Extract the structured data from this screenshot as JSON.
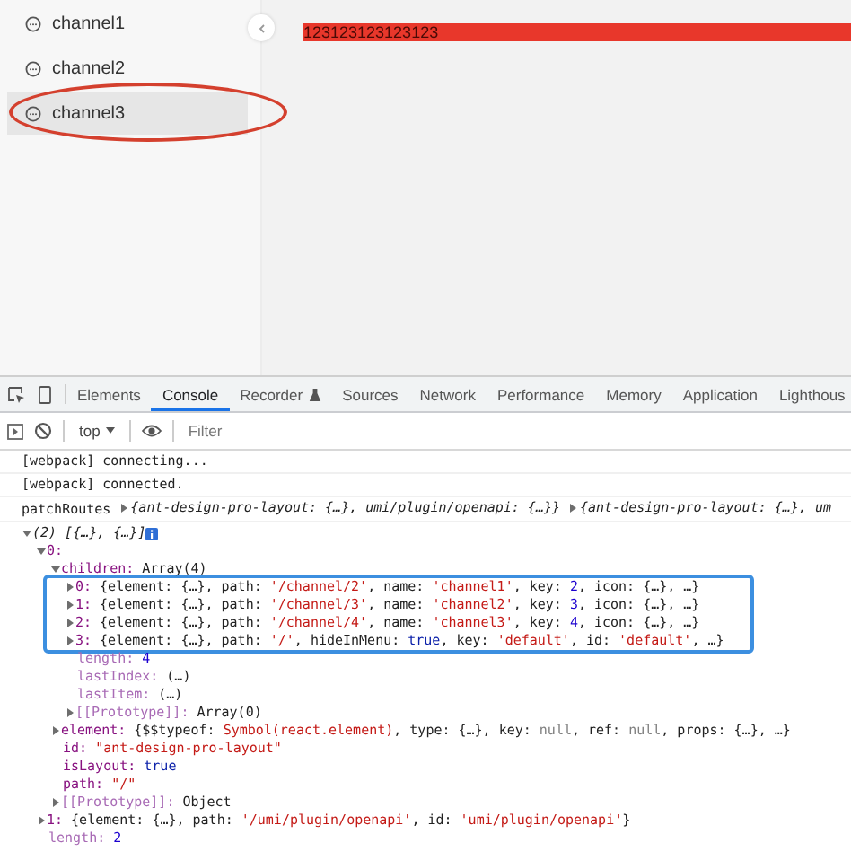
{
  "sidebar": {
    "items": [
      {
        "label": "channel1",
        "selected": false,
        "circled": false
      },
      {
        "label": "channel2",
        "selected": false,
        "circled": false
      },
      {
        "label": "channel3",
        "selected": true,
        "circled": true
      }
    ]
  },
  "content": {
    "banner": "123123123123123"
  },
  "devtools": {
    "tabs": [
      {
        "label": "Elements",
        "selected": false,
        "kind": "plain"
      },
      {
        "label": "Console",
        "selected": true,
        "kind": "plain"
      },
      {
        "label": "Recorder",
        "selected": false,
        "kind": "flask"
      },
      {
        "label": "Sources",
        "selected": false,
        "kind": "plain"
      },
      {
        "label": "Network",
        "selected": false,
        "kind": "plain"
      },
      {
        "label": "Performance",
        "selected": false,
        "kind": "plain"
      },
      {
        "label": "Memory",
        "selected": false,
        "kind": "plain"
      },
      {
        "label": "Application",
        "selected": false,
        "kind": "plain"
      },
      {
        "label": "Lighthous",
        "selected": false,
        "kind": "plain"
      }
    ],
    "context": "top",
    "filter": {
      "placeholder": "Filter"
    }
  },
  "console": {
    "messages": [
      {
        "kind": "text",
        "text": "[webpack] connecting..."
      },
      {
        "kind": "text",
        "text": "[webpack] connected."
      },
      {
        "kind": "log",
        "label": "patchRoutes",
        "previews": [
          "{ant-design-pro-layout: {…}, umi/plugin/openapi: {…}}",
          "{ant-design-pro-layout: {…}, um"
        ]
      },
      {
        "kind": "tree",
        "root": {
          "kind": "toggle",
          "expanded": true,
          "info": true,
          "tokens": [
            {
              "kind": "italic",
              "text": "(2) [{…}, {…}]"
            }
          ],
          "children": [
            {
              "kind": "toggle",
              "expanded": true,
              "tokens": [
                {
                  "kind": "key",
                  "text": "0:"
                }
              ],
              "children": [
                {
                  "kind": "toggle",
                  "expanded": true,
                  "tokens": [
                    {
                      "kind": "key",
                      "text": "children: "
                    },
                    {
                      "kind": "text",
                      "text": "Array(4)"
                    }
                  ],
                  "children": [
                    {
                      "kind": "toggle",
                      "expanded": false,
                      "boxed": true,
                      "tokens": [
                        {
                          "kind": "key",
                          "text": "0: "
                        },
                        {
                          "kind": "text",
                          "text": "{element: {…}, path: "
                        },
                        {
                          "kind": "str",
                          "text": "'/channel/2'"
                        },
                        {
                          "kind": "text",
                          "text": ", name: "
                        },
                        {
                          "kind": "str",
                          "text": "'channel1'"
                        },
                        {
                          "kind": "text",
                          "text": ", key: "
                        },
                        {
                          "kind": "num",
                          "text": "2"
                        },
                        {
                          "kind": "text",
                          "text": ", icon: {…}, …}"
                        }
                      ]
                    },
                    {
                      "kind": "toggle",
                      "expanded": false,
                      "boxed": true,
                      "tokens": [
                        {
                          "kind": "key",
                          "text": "1: "
                        },
                        {
                          "kind": "text",
                          "text": "{element: {…}, path: "
                        },
                        {
                          "kind": "str",
                          "text": "'/channel/3'"
                        },
                        {
                          "kind": "text",
                          "text": ", name: "
                        },
                        {
                          "kind": "str",
                          "text": "'channel2'"
                        },
                        {
                          "kind": "text",
                          "text": ", key: "
                        },
                        {
                          "kind": "num",
                          "text": "3"
                        },
                        {
                          "kind": "text",
                          "text": ", icon: {…}, …}"
                        }
                      ]
                    },
                    {
                      "kind": "toggle",
                      "expanded": false,
                      "boxed": true,
                      "tokens": [
                        {
                          "kind": "key",
                          "text": "2: "
                        },
                        {
                          "kind": "text",
                          "text": "{element: {…}, path: "
                        },
                        {
                          "kind": "str",
                          "text": "'/channel/4'"
                        },
                        {
                          "kind": "text",
                          "text": ", name: "
                        },
                        {
                          "kind": "str",
                          "text": "'channel3'"
                        },
                        {
                          "kind": "text",
                          "text": ", key: "
                        },
                        {
                          "kind": "num",
                          "text": "4"
                        },
                        {
                          "kind": "text",
                          "text": ", icon: {…}, …}"
                        }
                      ]
                    },
                    {
                      "kind": "toggle",
                      "expanded": false,
                      "boxed": true,
                      "tokens": [
                        {
                          "kind": "key",
                          "text": "3: "
                        },
                        {
                          "kind": "text",
                          "text": "{element: {…}, path: "
                        },
                        {
                          "kind": "str",
                          "text": "'/'"
                        },
                        {
                          "kind": "text",
                          "text": ", hideInMenu: "
                        },
                        {
                          "kind": "bool",
                          "text": "true"
                        },
                        {
                          "kind": "text",
                          "text": ", key: "
                        },
                        {
                          "kind": "str",
                          "text": "'default'"
                        },
                        {
                          "kind": "text",
                          "text": ", id: "
                        },
                        {
                          "kind": "str",
                          "text": "'default'"
                        },
                        {
                          "kind": "text",
                          "text": ", …}"
                        }
                      ]
                    },
                    {
                      "kind": "plain",
                      "tokens": [
                        {
                          "kind": "dimkey",
                          "text": "length: "
                        },
                        {
                          "kind": "num",
                          "text": "4"
                        }
                      ]
                    },
                    {
                      "kind": "plain",
                      "tokens": [
                        {
                          "kind": "dimkey",
                          "text": "lastIndex: "
                        },
                        {
                          "kind": "text",
                          "text": "(…)"
                        }
                      ]
                    },
                    {
                      "kind": "plain",
                      "tokens": [
                        {
                          "kind": "dimkey",
                          "text": "lastItem: "
                        },
                        {
                          "kind": "text",
                          "text": "(…)"
                        }
                      ]
                    },
                    {
                      "kind": "toggle",
                      "expanded": false,
                      "tokens": [
                        {
                          "kind": "dimkey",
                          "text": "[[Prototype]]: "
                        },
                        {
                          "kind": "text",
                          "text": "Array(0)"
                        }
                      ]
                    }
                  ]
                },
                {
                  "kind": "toggle",
                  "expanded": false,
                  "tokens": [
                    {
                      "kind": "key",
                      "text": "element: "
                    },
                    {
                      "kind": "text",
                      "text": "{$$typeof: "
                    },
                    {
                      "kind": "str",
                      "text": "Symbol(react.element)"
                    },
                    {
                      "kind": "text",
                      "text": ", type: {…}, key: "
                    },
                    {
                      "kind": "null",
                      "text": "null"
                    },
                    {
                      "kind": "text",
                      "text": ", ref: "
                    },
                    {
                      "kind": "null",
                      "text": "null"
                    },
                    {
                      "kind": "text",
                      "text": ", props: {…}, …}"
                    }
                  ]
                },
                {
                  "kind": "plain",
                  "tokens": [
                    {
                      "kind": "key",
                      "text": "id: "
                    },
                    {
                      "kind": "str",
                      "text": "\"ant-design-pro-layout\""
                    }
                  ]
                },
                {
                  "kind": "plain",
                  "tokens": [
                    {
                      "kind": "key",
                      "text": "isLayout: "
                    },
                    {
                      "kind": "bool",
                      "text": "true"
                    }
                  ]
                },
                {
                  "kind": "plain",
                  "tokens": [
                    {
                      "kind": "key",
                      "text": "path: "
                    },
                    {
                      "kind": "str",
                      "text": "\"/\""
                    }
                  ]
                },
                {
                  "kind": "toggle",
                  "expanded": false,
                  "tokens": [
                    {
                      "kind": "dimkey",
                      "text": "[[Prototype]]: "
                    },
                    {
                      "kind": "text",
                      "text": "Object"
                    }
                  ]
                }
              ]
            },
            {
              "kind": "toggle",
              "expanded": false,
              "tokens": [
                {
                  "kind": "key",
                  "text": "1: "
                },
                {
                  "kind": "text",
                  "text": "{element: {…}, path: "
                },
                {
                  "kind": "str",
                  "text": "'/umi/plugin/openapi'"
                },
                {
                  "kind": "text",
                  "text": ", id: "
                },
                {
                  "kind": "str",
                  "text": "'umi/plugin/openapi'"
                },
                {
                  "kind": "text",
                  "text": "}"
                }
              ]
            },
            {
              "kind": "plain",
              "tokens": [
                {
                  "kind": "dimkey",
                  "text": "length: "
                },
                {
                  "kind": "num",
                  "text": "2"
                }
              ]
            }
          ]
        }
      }
    ]
  }
}
